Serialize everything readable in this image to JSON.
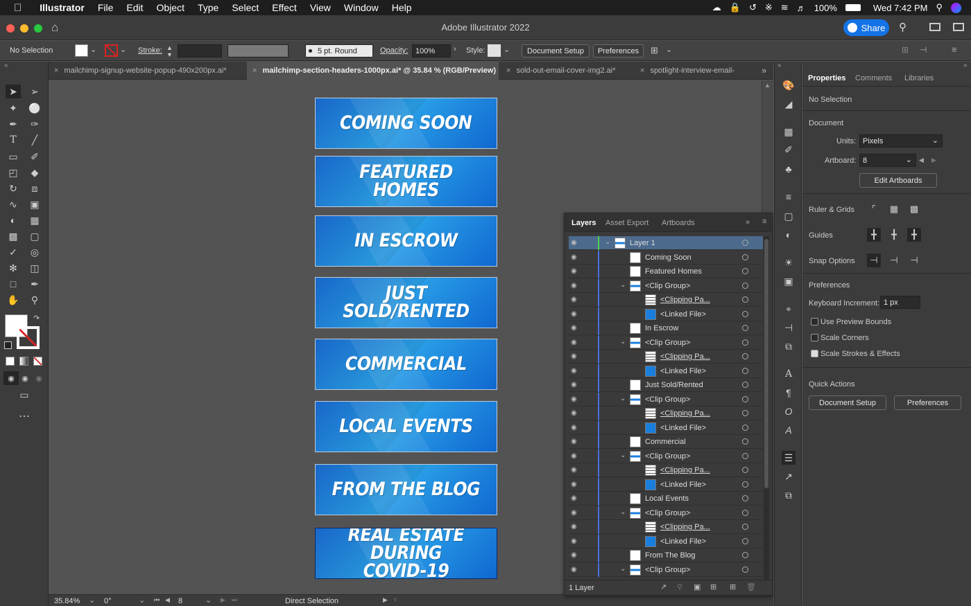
{
  "menubar": {
    "app_name": "Illustrator",
    "items": [
      "File",
      "Edit",
      "Object",
      "Type",
      "Select",
      "Effect",
      "View",
      "Window",
      "Help"
    ],
    "battery": "100%",
    "clock": "Wed 7:42 PM"
  },
  "window": {
    "title": "Adobe Illustrator 2022",
    "share_label": "Share"
  },
  "control_bar": {
    "selection_status": "No Selection",
    "stroke_label": "Stroke:",
    "brush": "5 pt. Round",
    "opacity_label": "Opacity:",
    "opacity_value": "100%",
    "style_label": "Style:",
    "document_setup": "Document Setup",
    "preferences": "Preferences"
  },
  "tabs": [
    {
      "label": "mailchimp-signup-website-popup-490x200px.ai*",
      "active": false
    },
    {
      "label": "mailchimp-section-headers-1000px.ai* @ 35.84 % (RGB/Preview)",
      "active": true
    },
    {
      "label": "sold-out-email-cover-img2.ai*",
      "active": false
    },
    {
      "label": "spotlight-interview-email-",
      "active": false
    }
  ],
  "artboards": [
    {
      "text": "COMING SOON"
    },
    {
      "text": "FEATURED HOMES"
    },
    {
      "text": "IN ESCROW"
    },
    {
      "text": "JUST SOLD/RENTED"
    },
    {
      "text": "COMMERCIAL"
    },
    {
      "text": "LOCAL EVENTS"
    },
    {
      "text": "FROM THE BLOG"
    },
    {
      "text": "REAL ESTATE DURING COVID-19"
    }
  ],
  "status_bar": {
    "zoom": "35.84%",
    "rotation": "0°",
    "artboard": "8",
    "tool": "Direct Selection"
  },
  "layers_panel": {
    "tabs": [
      "Layers",
      "Asset Export",
      "Artboards"
    ],
    "rows": [
      {
        "name": "Layer 1",
        "indent": 0,
        "expandable": true,
        "kind": "layer"
      },
      {
        "name": "Coming Soon",
        "indent": 1,
        "expandable": false,
        "kind": "image"
      },
      {
        "name": "Featured Homes",
        "indent": 1,
        "expandable": false,
        "kind": "image"
      },
      {
        "name": "<Clip Group>",
        "indent": 1,
        "expandable": true,
        "kind": "group"
      },
      {
        "name": "<Clipping Pa...",
        "indent": 2,
        "expandable": false,
        "kind": "path"
      },
      {
        "name": "<Linked File>",
        "indent": 2,
        "expandable": false,
        "kind": "linked"
      },
      {
        "name": "In Escrow",
        "indent": 1,
        "expandable": false,
        "kind": "image"
      },
      {
        "name": "<Clip Group>",
        "indent": 1,
        "expandable": true,
        "kind": "group"
      },
      {
        "name": "<Clipping Pa...",
        "indent": 2,
        "expandable": false,
        "kind": "path"
      },
      {
        "name": "<Linked File>",
        "indent": 2,
        "expandable": false,
        "kind": "linked"
      },
      {
        "name": "Just Sold/Rented",
        "indent": 1,
        "expandable": false,
        "kind": "image"
      },
      {
        "name": "<Clip Group>",
        "indent": 1,
        "expandable": true,
        "kind": "group"
      },
      {
        "name": "<Clipping Pa...",
        "indent": 2,
        "expandable": false,
        "kind": "path"
      },
      {
        "name": "<Linked File>",
        "indent": 2,
        "expandable": false,
        "kind": "linked"
      },
      {
        "name": "Commercial",
        "indent": 1,
        "expandable": false,
        "kind": "image"
      },
      {
        "name": "<Clip Group>",
        "indent": 1,
        "expandable": true,
        "kind": "group"
      },
      {
        "name": "<Clipping Pa...",
        "indent": 2,
        "expandable": false,
        "kind": "path"
      },
      {
        "name": "<Linked File>",
        "indent": 2,
        "expandable": false,
        "kind": "linked"
      },
      {
        "name": "Local Events",
        "indent": 1,
        "expandable": false,
        "kind": "image"
      },
      {
        "name": "<Clip Group>",
        "indent": 1,
        "expandable": true,
        "kind": "group"
      },
      {
        "name": "<Clipping Pa...",
        "indent": 2,
        "expandable": false,
        "kind": "path"
      },
      {
        "name": "<Linked File>",
        "indent": 2,
        "expandable": false,
        "kind": "linked"
      },
      {
        "name": "From The Blog",
        "indent": 1,
        "expandable": false,
        "kind": "image"
      },
      {
        "name": "<Clip Group>",
        "indent": 1,
        "expandable": true,
        "kind": "group"
      }
    ],
    "footer_count": "1 Layer"
  },
  "properties_panel": {
    "tabs": [
      "Properties",
      "Comments",
      "Libraries"
    ],
    "selection": "No Selection",
    "document_heading": "Document",
    "units_label": "Units:",
    "units_value": "Pixels",
    "artboard_label": "Artboard:",
    "artboard_value": "8",
    "edit_artboards": "Edit Artboards",
    "ruler_grids": "Ruler & Grids",
    "guides": "Guides",
    "snap_options": "Snap Options",
    "preferences_heading": "Preferences",
    "keyboard_increment_label": "Keyboard Increment:",
    "keyboard_increment_value": "1 px",
    "use_preview_bounds": "Use Preview Bounds",
    "scale_corners": "Scale Corners",
    "scale_strokes": "Scale Strokes & Effects",
    "quick_actions": "Quick Actions",
    "document_setup": "Document Setup",
    "preferences": "Preferences"
  },
  "colors": {
    "accent": "#1473e6",
    "canvas": "#535353",
    "panel": "#3c3c3c",
    "artboard_blue": "#1a7fdc"
  }
}
